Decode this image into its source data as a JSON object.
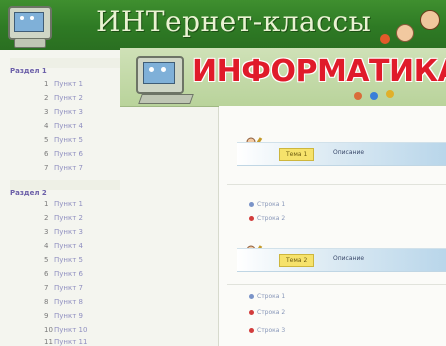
{
  "header": {
    "title": "ИНТернет-классы"
  },
  "banner": {
    "title": "ИНФОРМАТИКА"
  },
  "sidebar": {
    "groups": [
      {
        "title": "Раздел 1",
        "items": [
          {
            "num": "1",
            "label": "Пункт 1"
          },
          {
            "num": "2",
            "label": "Пункт 2"
          },
          {
            "num": "3",
            "label": "Пункт 3"
          },
          {
            "num": "4",
            "label": "Пункт 4"
          },
          {
            "num": "5",
            "label": "Пункт 5"
          },
          {
            "num": "6",
            "label": "Пункт 6"
          },
          {
            "num": "7",
            "label": "Пункт 7"
          }
        ]
      },
      {
        "title": "Раздел 2",
        "items": [
          {
            "num": "1",
            "label": "Пункт 1"
          },
          {
            "num": "2",
            "label": "Пункт 2"
          },
          {
            "num": "3",
            "label": "Пункт 3"
          },
          {
            "num": "4",
            "label": "Пункт 4"
          },
          {
            "num": "5",
            "label": "Пункт 5"
          },
          {
            "num": "6",
            "label": "Пункт 6"
          },
          {
            "num": "7",
            "label": "Пункт 7"
          },
          {
            "num": "8",
            "label": "Пункт 8"
          },
          {
            "num": "9",
            "label": "Пункт 9"
          },
          {
            "num": "10",
            "label": "Пункт 10"
          },
          {
            "num": "11",
            "label": "Пункт 11"
          }
        ]
      }
    ]
  },
  "content": {
    "sections": [
      {
        "tag": "Тема 1",
        "desc": "Описание",
        "rows": [
          "Строка 1",
          "Строка 2"
        ]
      },
      {
        "tag": "Тема 2",
        "desc": "Описание",
        "rows": [
          "Строка 1",
          "Строка 2",
          "Строка 3"
        ]
      }
    ]
  },
  "colors": {
    "header": "#2e7a24",
    "accent_red": "#e01b2a",
    "link": "#8f8fc0",
    "section_head": "#6b5fa8"
  }
}
